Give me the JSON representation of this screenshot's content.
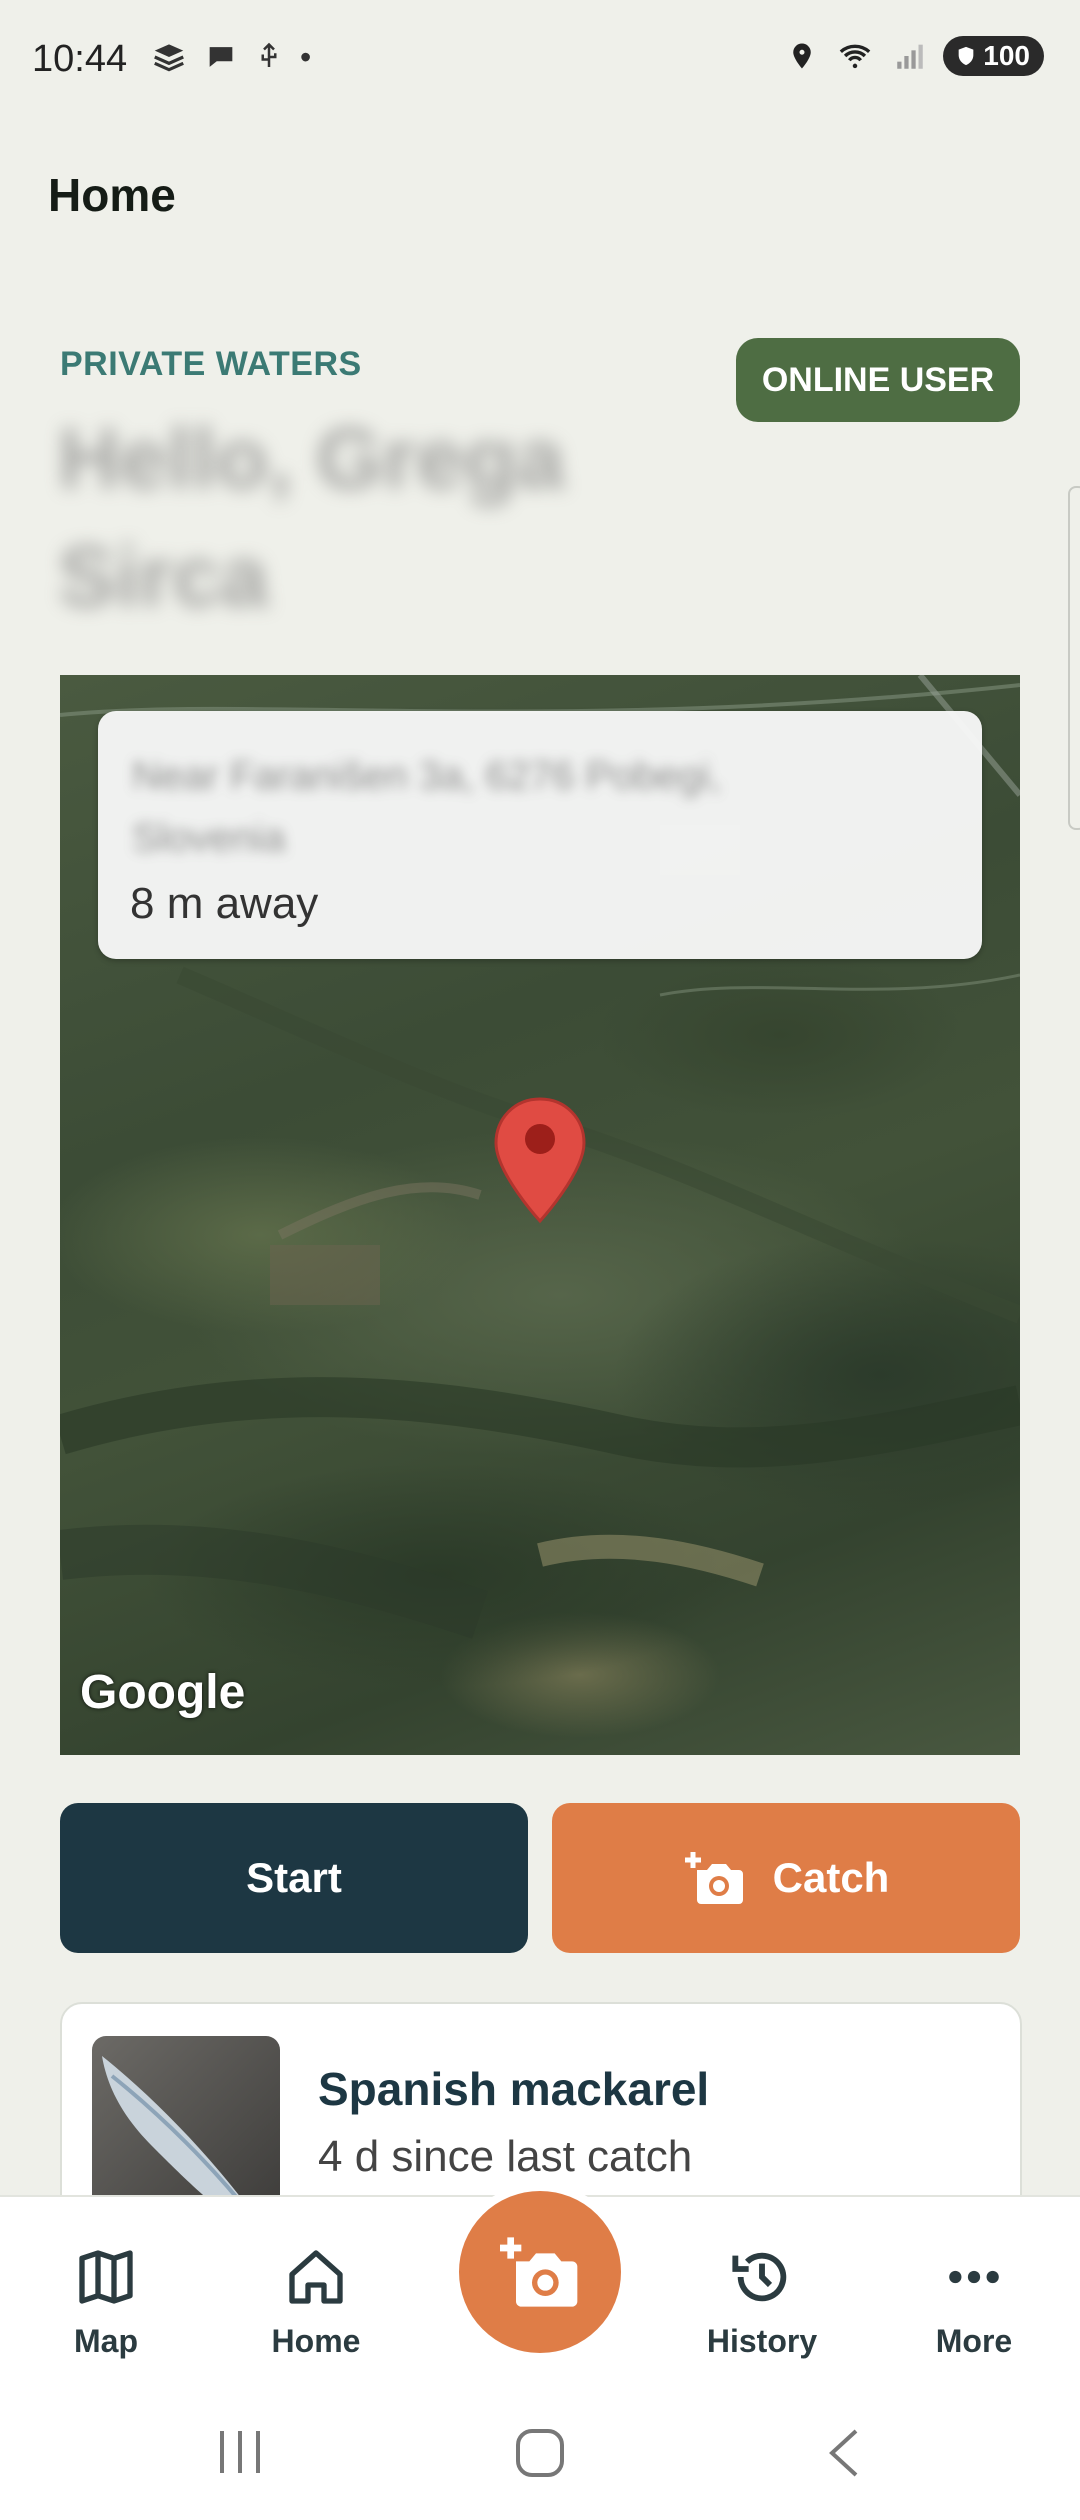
{
  "status_bar": {
    "time": "10:44",
    "battery": "100"
  },
  "header": {
    "title": "Home"
  },
  "hero": {
    "section_label": "PRIVATE WATERS",
    "badge": "ONLINE USER",
    "greeting": "Hello, Grega Sirca"
  },
  "map": {
    "address": "Near Faranišen 3a, 6276 Pobegi, Slovenia",
    "distance": "8 m away",
    "logo": "Google"
  },
  "actions": {
    "start_label": "Start",
    "catch_label": "Catch"
  },
  "last_catch": {
    "species": "Spanish mackarel",
    "since": "4 d since last catch"
  },
  "bottom_nav": {
    "items": [
      {
        "label": "Map",
        "icon": "map-icon"
      },
      {
        "label": "Home",
        "icon": "home-icon"
      },
      {
        "label": "History",
        "icon": "history-icon"
      },
      {
        "label": "More",
        "icon": "more-icon"
      }
    ],
    "fab_icon": "add-photo-icon"
  },
  "colors": {
    "background": "#eff0ea",
    "accent_teal": "#3b7a74",
    "badge_green": "#4e6d43",
    "start_navy": "#1d3743",
    "catch_orange": "#df7d47"
  }
}
